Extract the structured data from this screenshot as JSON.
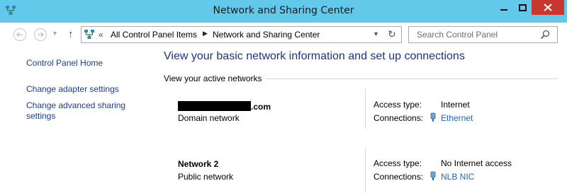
{
  "window": {
    "title": "Network and Sharing Center",
    "app_icon": "network-center-icon",
    "controls": [
      "minimize-icon",
      "maximize-icon",
      "close-icon"
    ]
  },
  "navigation": {
    "back_icon": "back-arrow-icon",
    "forward_icon": "forward-arrow-icon",
    "up_icon": "up-arrow-icon",
    "address": {
      "overflow": "«",
      "breadcrumbs": [
        "All Control Panel Items",
        "Network and Sharing Center"
      ],
      "separator": "▶"
    },
    "refresh_icon": "refresh-icon",
    "search": {
      "placeholder": "Search Control Panel",
      "icon": "search-icon"
    }
  },
  "sidebar": {
    "items": [
      {
        "label": "Control Panel Home"
      },
      {
        "label": "Change adapter settings"
      },
      {
        "label": "Change advanced sharing settings",
        "line1": "Change advanced sharing",
        "line2": "settings"
      }
    ]
  },
  "main": {
    "heading": "View your basic network information and set up connections",
    "section_label": "View your active networks",
    "networks": [
      {
        "name_suffix": ".com",
        "name_redacted": true,
        "type": "Domain network",
        "access_label": "Access type:",
        "access_value": "Internet",
        "connections_label": "Connections:",
        "connection": "Ethernet"
      },
      {
        "name": "Network  2",
        "type": "Public network",
        "access_label": "Access type:",
        "access_value": "No Internet access",
        "connections_label": "Connections:",
        "connection": "NLB NIC"
      }
    ]
  },
  "colors": {
    "titlebar": "#62c9ea",
    "close_button": "#c7372f",
    "heading": "#1e3287",
    "link": "#1a65b7",
    "sidebar_link": "#1a3c91"
  }
}
